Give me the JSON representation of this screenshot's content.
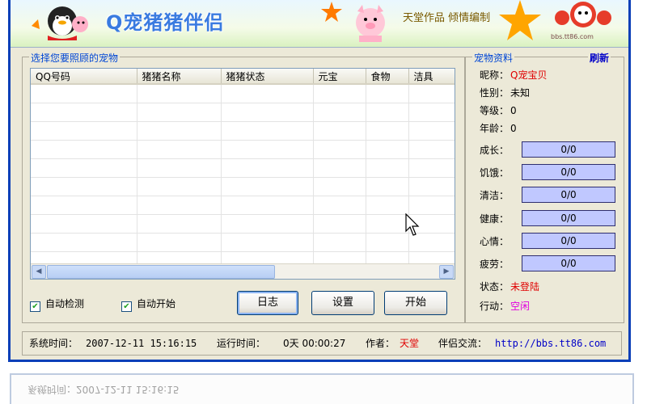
{
  "banner": {
    "title": "Q宠猪猪伴侣",
    "author_text": "天堂作品   倾情编制",
    "watermark": "bbs.tt86.com"
  },
  "pets_list": {
    "group_label": "选择您要照顾的宠物",
    "columns": [
      "QQ号码",
      "猪猪名称",
      "猪猪状态",
      "元宝",
      "食物",
      "洁具"
    ],
    "rows": []
  },
  "options": {
    "auto_detect": {
      "label": "自动检测",
      "checked": true
    },
    "auto_start": {
      "label": "自动开始",
      "checked": true
    }
  },
  "buttons": {
    "log": "日志",
    "settings": "设置",
    "start": "开始"
  },
  "pet_info": {
    "group_label": "宠物资料",
    "refresh": "刷新",
    "nickname_label": "昵称：",
    "nickname": "Q宠宝贝",
    "gender_label": "性别：",
    "gender": "未知",
    "level_label": "等级：",
    "level": "0",
    "age_label": "年龄：",
    "age": "0",
    "stats": [
      {
        "label": "成长：",
        "value": "0/0"
      },
      {
        "label": "饥饿：",
        "value": "0/0"
      },
      {
        "label": "清洁：",
        "value": "0/0"
      },
      {
        "label": "健康：",
        "value": "0/0"
      },
      {
        "label": "心情：",
        "value": "0/0"
      },
      {
        "label": "疲劳：",
        "value": "0/0"
      }
    ],
    "status_label": "状态：",
    "status": "未登陆",
    "action_label": "行动：",
    "action": "空闲"
  },
  "statusbar": {
    "system_time_label": "系统时间：",
    "system_time": "2007-12-11 15:16:15",
    "run_time_label": "运行时间：",
    "run_time": "0天 00:00:27",
    "author_label": "作者：",
    "author": "天堂",
    "forum_label": "伴侣交流：",
    "forum_url": "http://bbs.tt86.com"
  },
  "colors": {
    "title_blue": "#3a7be0",
    "window_border": "#0a3fb8",
    "group_label_blue": "#0046d5",
    "value_red": "#e00000",
    "value_magenta": "#e000e0",
    "bar_fill": "#c0c8ff"
  }
}
